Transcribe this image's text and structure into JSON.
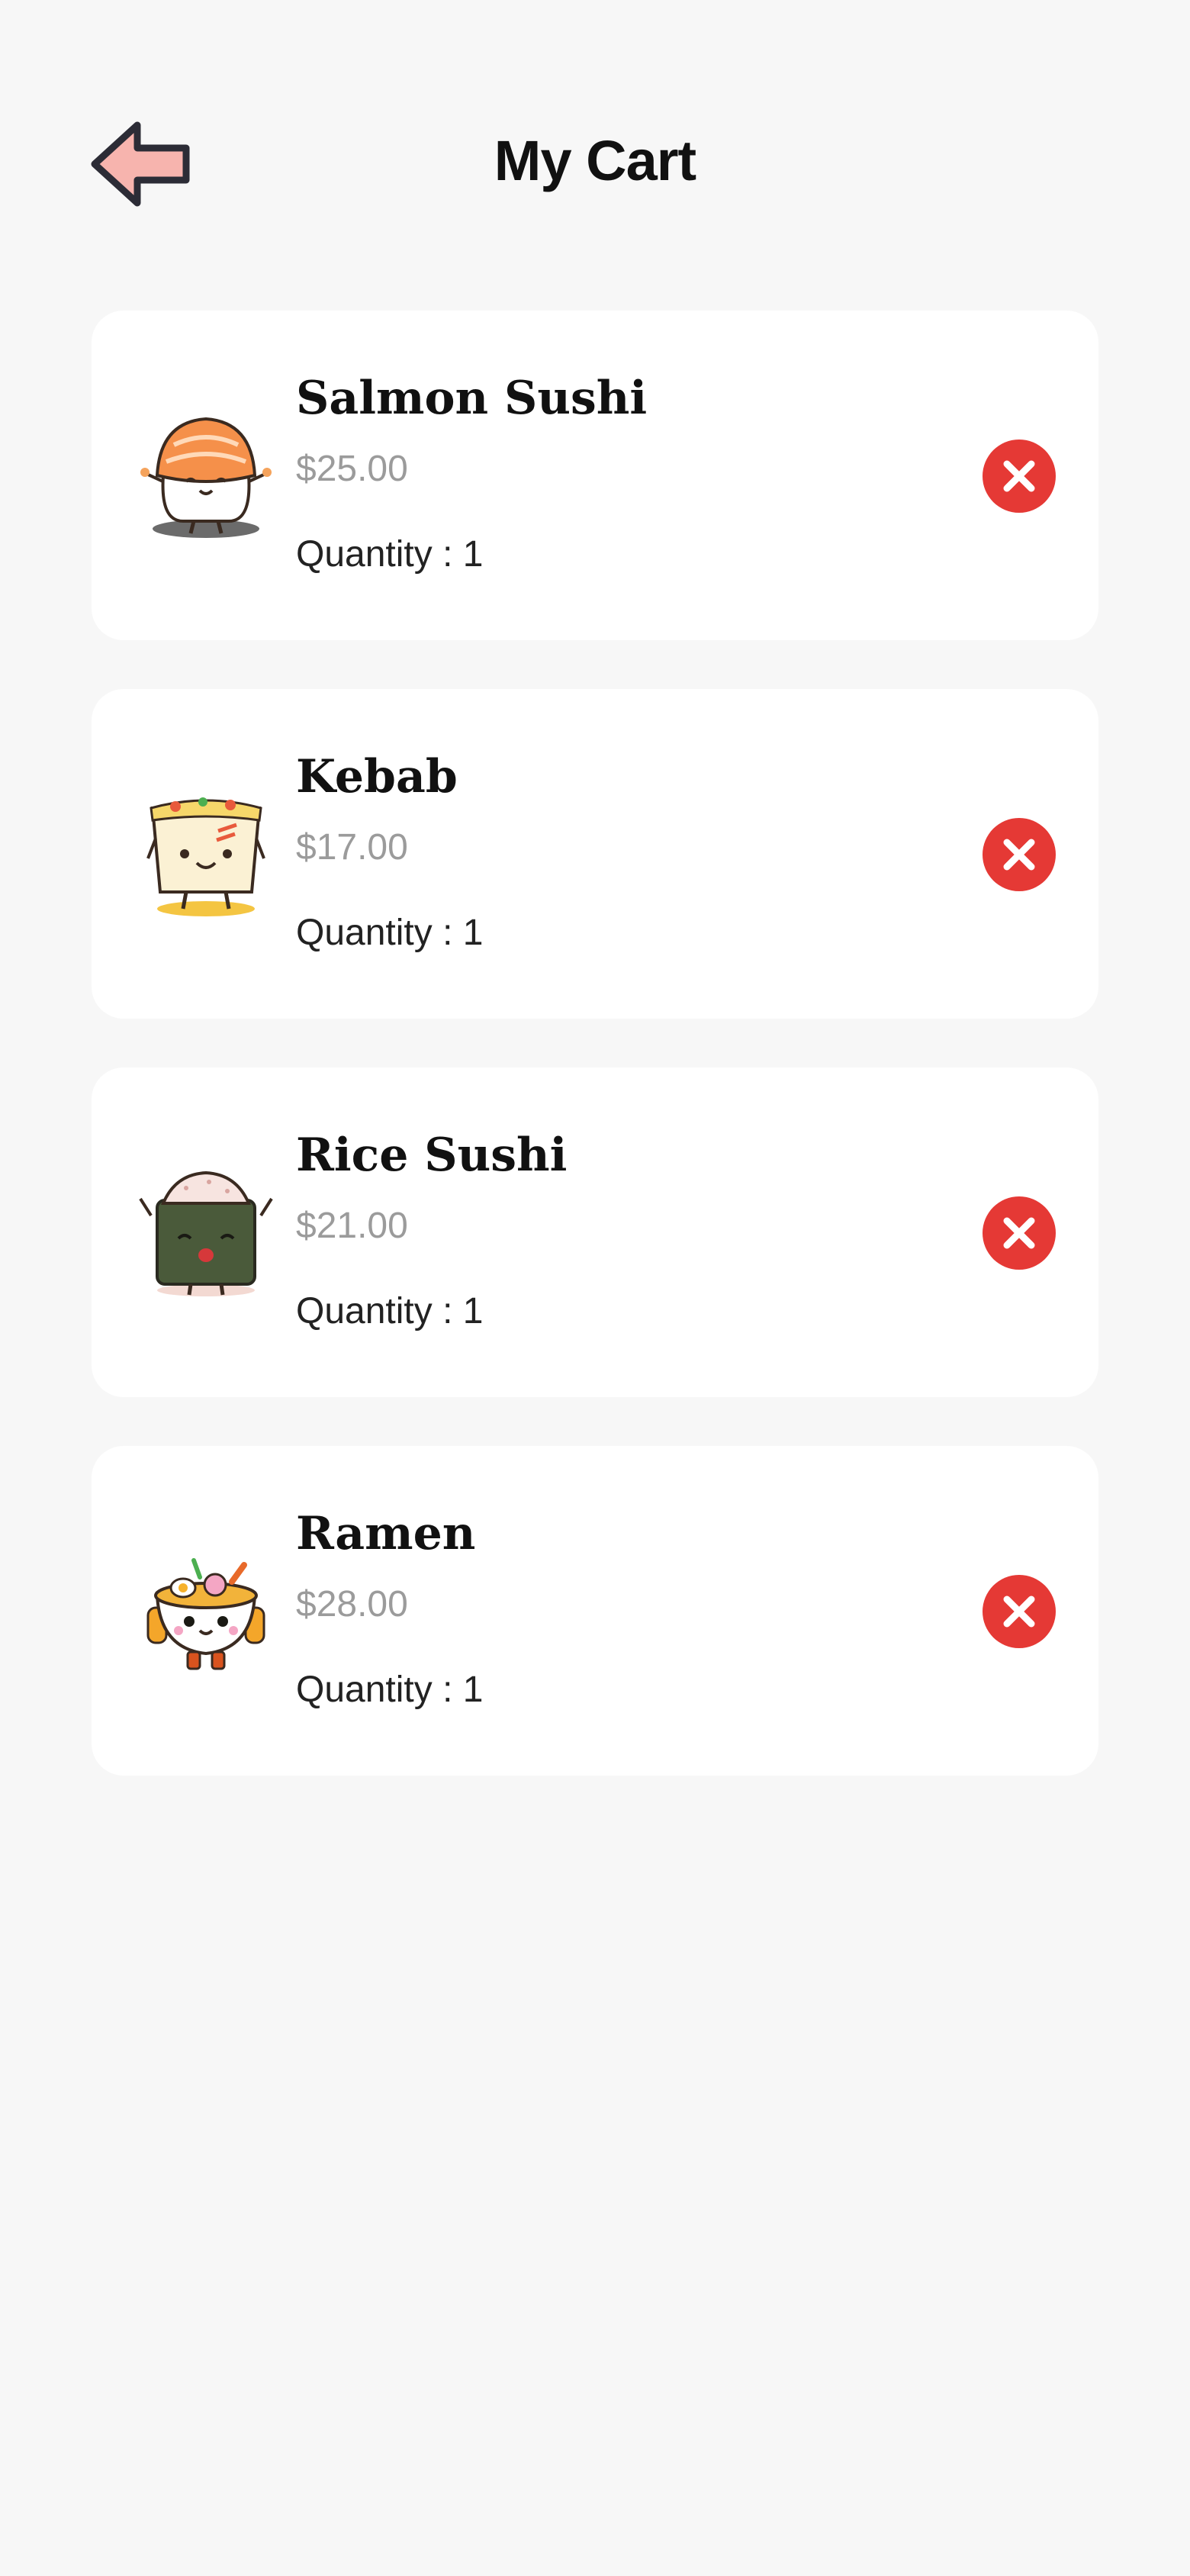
{
  "header": {
    "title": "My Cart",
    "back_icon": "arrow-left-icon"
  },
  "colors": {
    "background": "#f7f7f7",
    "card": "#ffffff",
    "remove": "#e53935",
    "price": "#9b9b9b",
    "back_arrow_fill": "#f7b4ae"
  },
  "cart": {
    "items": [
      {
        "name": "Salmon Sushi",
        "price": "$25.00",
        "quantity": "Quantity : 1",
        "icon": "salmon-sushi-icon"
      },
      {
        "name": "Kebab",
        "price": "$17.00",
        "quantity": "Quantity : 1",
        "icon": "kebab-icon"
      },
      {
        "name": "Rice Sushi",
        "price": "$21.00",
        "quantity": "Quantity : 1",
        "icon": "rice-sushi-icon"
      },
      {
        "name": "Ramen",
        "price": "$28.00",
        "quantity": "Quantity : 1",
        "icon": "ramen-icon"
      }
    ],
    "remove_icon": "close-icon"
  }
}
